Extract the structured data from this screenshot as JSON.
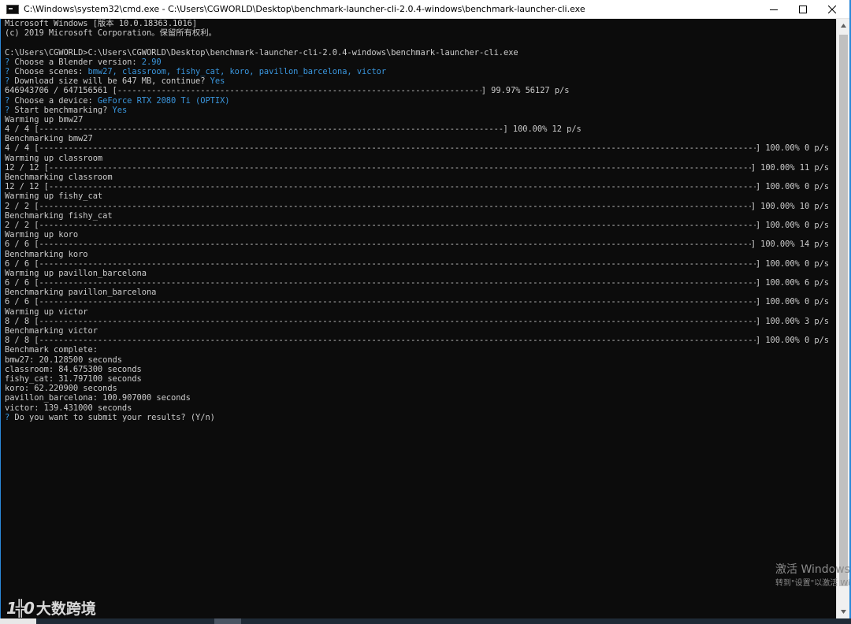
{
  "window": {
    "title": "C:\\Windows\\system32\\cmd.exe - C:\\Users\\CGWORLD\\Desktop\\benchmark-launcher-cli-2.0.4-windows\\benchmark-launcher-cli.exe",
    "minimize": "minimize-icon",
    "maximize": "maximize-icon",
    "close": "close-icon"
  },
  "colors": {
    "console_bg": "#0c0c0c",
    "console_text": "#cccccc",
    "accent": "#3a96dd"
  },
  "console": {
    "header": [
      "Microsoft Windows [版本 10.0.18363.1016]",
      "(c) 2019 Microsoft Corporation。保留所有权利。"
    ],
    "command": "C:\\Users\\CGWORLD>C:\\Users\\CGWORLD\\Desktop\\benchmark-launcher-cli-2.0.4-windows\\benchmark-launcher-cli.exe",
    "q_blender": {
      "mark": "?",
      "text": " Choose a Blender version: ",
      "answer": "2.90"
    },
    "q_scenes": {
      "mark": "?",
      "text": " Choose scenes: ",
      "answer": "bmw27, classroom, fishy_cat, koro, pavillon_barcelona, victor"
    },
    "q_download": {
      "mark": "?",
      "text": " Download size will be 647 MB, continue? ",
      "answer": "Yes"
    },
    "download_bar": {
      "left": "646943706 / 647156561 [",
      "right": "] 99.97% 56127 p/s"
    },
    "q_device": {
      "mark": "?",
      "text": " Choose a device: ",
      "answer": "GeForce RTX 2080 Ti (OPTIX)"
    },
    "q_start": {
      "mark": "?",
      "text": " Start benchmarking? ",
      "answer": "Yes"
    },
    "warm_bmw": "Warming up bmw27",
    "warm_bmw_bar": {
      "left": "4 / 4 [",
      "right": "] 100.00% 12 p/s"
    },
    "runs": [
      {
        "label": "Benchmarking bmw27",
        "left": "4 / 4 [",
        "right": "] 100.00% 0 p/s"
      },
      {
        "label": "Warming up classroom",
        "left": "12 / 12 [",
        "right": "] 100.00% 11 p/s"
      },
      {
        "label": "Benchmarking classroom",
        "left": "12 / 12 [",
        "right": "] 100.00% 0 p/s"
      },
      {
        "label": "Warming up fishy_cat",
        "left": "2 / 2 [",
        "right": "] 100.00% 10 p/s"
      },
      {
        "label": "Benchmarking fishy_cat",
        "left": "2 / 2 [",
        "right": "] 100.00% 0 p/s"
      },
      {
        "label": "Warming up koro",
        "left": "6 / 6 [",
        "right": "] 100.00% 14 p/s"
      },
      {
        "label": "Benchmarking koro",
        "left": "6 / 6 [",
        "right": "] 100.00% 0 p/s"
      },
      {
        "label": "Warming up pavillon_barcelona",
        "left": "6 / 6 [",
        "right": "] 100.00% 6 p/s"
      },
      {
        "label": "Benchmarking pavillon_barcelona",
        "left": "6 / 6 [",
        "right": "] 100.00% 0 p/s"
      },
      {
        "label": "Warming up victor",
        "left": "8 / 8 [",
        "right": "] 100.00% 3 p/s"
      },
      {
        "label": "Benchmarking victor",
        "left": "8 / 8 [",
        "right": "] 100.00% 0 p/s"
      }
    ],
    "complete": "Benchmark complete:",
    "results": [
      "bmw27: 20.128500 seconds",
      "classroom: 84.675300 seconds",
      "fishy_cat: 31.797100 seconds",
      "koro: 62.220900 seconds",
      "pavillon_barcelona: 100.907000 seconds",
      "victor: 139.431000 seconds"
    ],
    "q_submit": {
      "mark": "?",
      "text": " Do you want to submit your results? (Y/n)"
    }
  },
  "watermark": {
    "activate_title": "激活 Windows",
    "activate_sub": "转到\"设置\"以激活 Windows。",
    "brand_mark": "1╬0",
    "brand_text": "大数跨境"
  }
}
